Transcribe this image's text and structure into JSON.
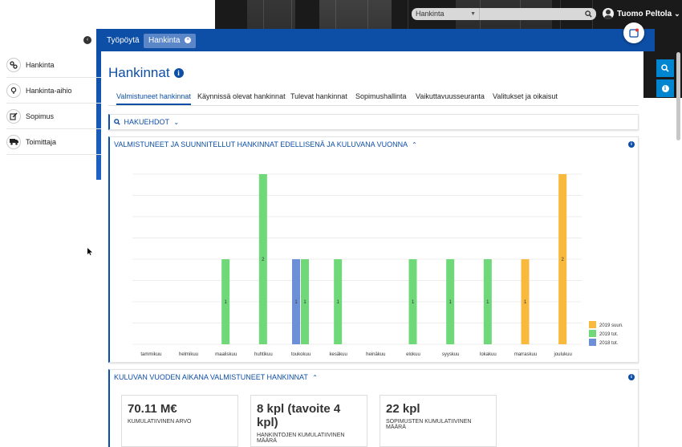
{
  "header": {
    "search_select": "Hankinta",
    "user_name": "Tuomo Peltola"
  },
  "top_tabs": [
    {
      "label": "Työpöytä"
    },
    {
      "label": "Hankinta"
    }
  ],
  "sidebar": {
    "items": [
      {
        "label": "Hankinta",
        "icon": "link-icon"
      },
      {
        "label": "Hankinta-aihio",
        "icon": "lightbulb-icon"
      },
      {
        "label": "Sopimus",
        "icon": "edit-icon"
      },
      {
        "label": "Toimittaja",
        "icon": "truck-icon"
      }
    ]
  },
  "main": {
    "title": "Hankinnat",
    "subtabs": [
      {
        "label": "Valmistuneet hankinnat"
      },
      {
        "label": "Käynnissä olevat hankinnat"
      },
      {
        "label": "Tulevat hankinnat"
      },
      {
        "label": "Sopimushallinta"
      },
      {
        "label": "Vaikuttavuusseuranta"
      },
      {
        "label": "Valitukset ja oikaisut"
      }
    ],
    "search_panel": "HAKUEHDOT",
    "chart_panel": "VALMISTUNEET JA SUUNNITELLUT HANKINNAT EDELLISENÄ JA KULUVANA VUONNA",
    "kpi_panel": "KULUVAN VUODEN AIKANA VALMISTUNEET HANKINNAT",
    "kpis": [
      {
        "value": "70.11 M€",
        "label": "KUMULATIIVINEN ARVO"
      },
      {
        "value": "8 kpl (tavoite 4 kpl)",
        "label": "HANKINTOJEN KUMULATIIVINEN MÄÄRÄ"
      },
      {
        "value": "22 kpl",
        "label": "SOPIMUSTEN KUMULATIIVINEN MÄÄRÄ"
      }
    ]
  },
  "colors": {
    "primary": "#0d4ea6",
    "accent": "#0086d1",
    "s2019suun": "#f9b93c",
    "s2019tot": "#6fd97a",
    "s2018tot": "#6d8fd8"
  },
  "chart_data": {
    "type": "bar",
    "categories": [
      "tammikuu",
      "helmikuu",
      "maaliskuu",
      "huhtikuu",
      "toukokuu",
      "kesäkuu",
      "heinäkuu",
      "elokuu",
      "syyskuu",
      "lokakuu",
      "marraskuu",
      "joulukuu"
    ],
    "series": [
      {
        "name": "2018 tot.",
        "values": [
          0,
          0,
          0,
          0,
          1,
          0,
          0,
          0,
          0,
          0,
          0,
          0
        ]
      },
      {
        "name": "2019 tot.",
        "values": [
          0,
          0,
          1,
          2,
          1,
          1,
          0,
          1,
          1,
          1,
          0,
          0
        ]
      },
      {
        "name": "2019 suun.",
        "values": [
          0,
          0,
          0,
          0,
          0,
          0,
          0,
          0,
          0,
          0,
          1,
          2
        ]
      }
    ],
    "ylim": [
      0,
      2
    ],
    "legend": "bottom-right"
  }
}
